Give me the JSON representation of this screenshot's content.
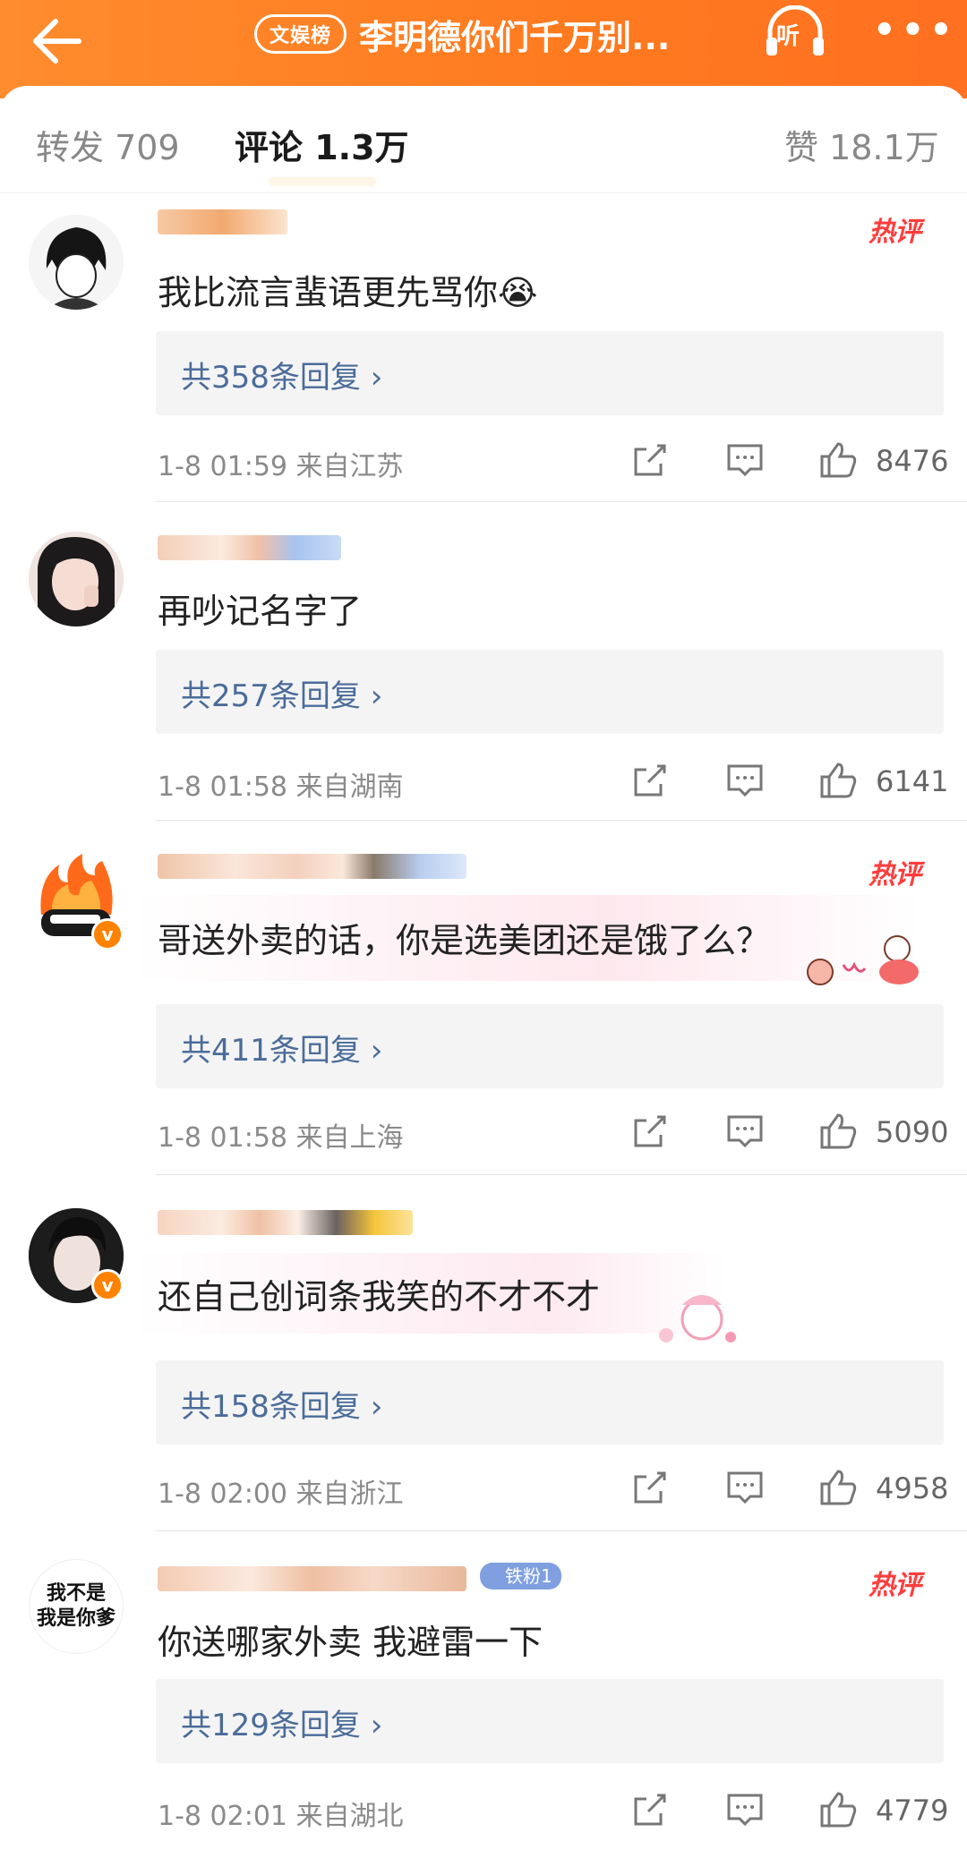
{
  "header": {
    "badge": "文娱榜",
    "title": "李明德你们千万别...",
    "listen_label": "听",
    "more_label": "•••"
  },
  "tabs": {
    "repost": "转发 709",
    "comment": "评论 1.3万",
    "like": "赞 18.1万"
  },
  "comments": [
    {
      "text": "我比流言蜚语更先骂你😭",
      "hot": "热评",
      "reply": "共358条回复 ›",
      "time": "1-8 01:59",
      "location": "来自江苏",
      "likes": "8476"
    },
    {
      "text": "再吵记名字了",
      "hot": "",
      "reply": "共257条回复 ›",
      "time": "1-8 01:58",
      "location": "来自湖南",
      "likes": "6141"
    },
    {
      "text": "哥送外卖的话，你是选美团还是饿了么？",
      "hot": "热评",
      "reply": "共411条回复 ›",
      "time": "1-8 01:58",
      "location": "来自上海",
      "likes": "5090"
    },
    {
      "text": "还自己创词条我笑的不才不才",
      "hot": "",
      "reply": "共158条回复 ›",
      "time": "1-8 02:00",
      "location": "来自浙江",
      "likes": "4958"
    },
    {
      "text": "你送哪家外卖 我避雷一下",
      "hot": "热评",
      "reply": "共129条回复 ›",
      "time": "1-8 02:01",
      "location": "来自湖北",
      "likes": "4779",
      "fan_badge": "铁粉1",
      "avatar_text_1": "我不是",
      "avatar_text_2": "我是你爹"
    }
  ],
  "colors": {
    "accent": "#ff7a1f",
    "hot": "#ff3d3d",
    "reply_link": "#4a6c9a"
  }
}
